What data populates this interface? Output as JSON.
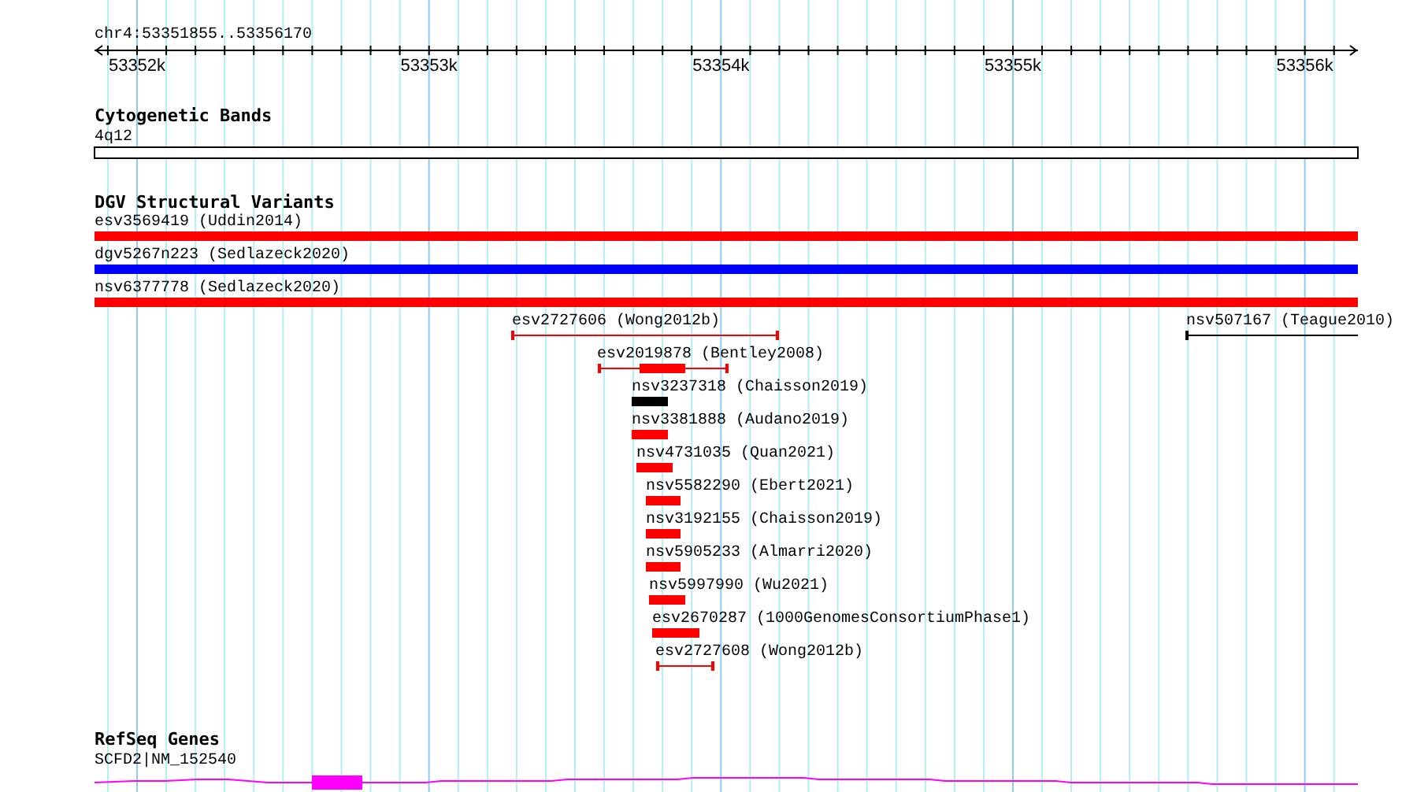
{
  "ruler": {
    "location": "chr4:53351855..53356170",
    "ticks": [
      "53352k",
      "53353k",
      "53354k",
      "53355k",
      "53356k"
    ]
  },
  "tracks": [
    {
      "title": "Cytogenetic Bands",
      "kind": "bands",
      "features": [
        {
          "label": "4q12"
        }
      ]
    },
    {
      "title": "DGV Structural Variants",
      "kind": "variants",
      "features": [
        {
          "label": "esv3569419 (Uddin2014)",
          "kind": "bar",
          "color": "#ff0000"
        },
        {
          "label": "dgv5267n223 (Sedlazeck2020)",
          "kind": "bar",
          "color": "#0000ff"
        },
        {
          "label": "nsv6377778 (Sedlazeck2020)",
          "kind": "bar",
          "color": "#ff0000"
        },
        {
          "label": "esv2727606 (Wong2012b)",
          "kind": "span",
          "color": "#ff0000"
        },
        {
          "label": "nsv507167 (Teague2010)",
          "kind": "span",
          "color": "#000000"
        },
        {
          "label": "esv2019878 (Bentley2008)",
          "kind": "span_core",
          "color": "#ff0000"
        },
        {
          "label": "nsv3237318 (Chaisson2019)",
          "kind": "bar",
          "color": "#000000"
        },
        {
          "label": "nsv3381888 (Audano2019)",
          "kind": "bar",
          "color": "#ff0000"
        },
        {
          "label": "nsv4731035 (Quan2021)",
          "kind": "bar",
          "color": "#ff0000"
        },
        {
          "label": "nsv5582290 (Ebert2021)",
          "kind": "bar",
          "color": "#ff0000"
        },
        {
          "label": "nsv3192155 (Chaisson2019)",
          "kind": "bar",
          "color": "#ff0000"
        },
        {
          "label": "nsv5905233 (Almarri2020)",
          "kind": "bar",
          "color": "#ff0000"
        },
        {
          "label": "nsv5997990 (Wu2021)",
          "kind": "bar",
          "color": "#ff0000"
        },
        {
          "label": "esv2670287 (1000GenomesConsortiumPhase1)",
          "kind": "bar",
          "color": "#ff0000"
        },
        {
          "label": "esv2727608 (Wong2012b)",
          "kind": "span",
          "color": "#ff0000"
        }
      ]
    },
    {
      "title": "RefSeq Genes",
      "kind": "genes",
      "features": [
        {
          "label": "SCFD2|NM_152540",
          "color": "#ff00ff"
        }
      ]
    }
  ]
}
